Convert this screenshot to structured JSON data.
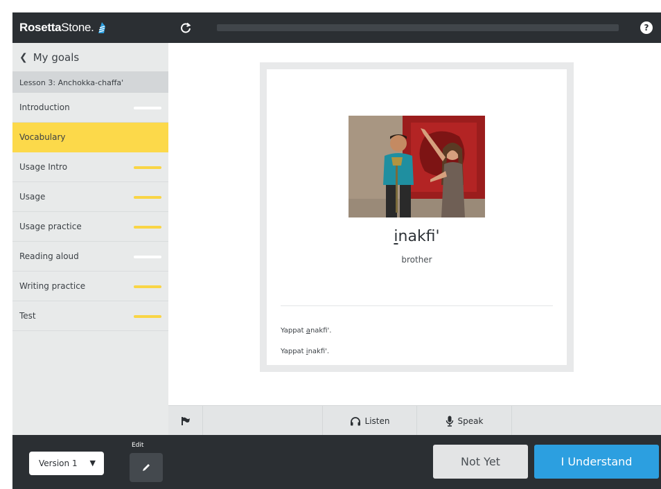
{
  "app": {
    "brand_bold": "Rosetta",
    "brand_light": "Stone."
  },
  "topbar": {
    "progress": 0.0,
    "help_label": "?"
  },
  "sidebar": {
    "back_label": "My goals",
    "lesson_title": "Lesson 3: Anchokka-chaffa'",
    "items": [
      {
        "label": "Introduction",
        "status": "white"
      },
      {
        "label": "Vocabulary",
        "status": "active"
      },
      {
        "label": "Usage Intro",
        "status": "yellow"
      },
      {
        "label": "Usage",
        "status": "yellow"
      },
      {
        "label": "Usage practice",
        "status": "yellow"
      },
      {
        "label": "Reading aloud",
        "status": "white"
      },
      {
        "label": "Writing practice",
        "status": "yellow"
      },
      {
        "label": "Test",
        "status": "yellow"
      }
    ],
    "version_label": "Version 1",
    "edit_label": "Edit"
  },
  "card": {
    "word_underlined": "i",
    "word_rest": "nakfi'",
    "translation": "brother",
    "sentences": [
      {
        "prefix": "Yappat ",
        "underlined": "a",
        "suffix": "nakfi'."
      },
      {
        "prefix": "Yappat ",
        "underlined": "i",
        "suffix": "nakfi'."
      }
    ]
  },
  "toolbar": {
    "listen_label": "Listen",
    "speak_label": "Speak"
  },
  "actions": {
    "not_yet_label": "Not Yet",
    "understand_label": "I Understand"
  },
  "colors": {
    "dark": "#2b2f33",
    "active_yellow": "#fcd94a",
    "progress_yellow": "#f9d545",
    "primary_blue": "#2c9fe0",
    "sidebar_bg": "#e8eaea"
  }
}
